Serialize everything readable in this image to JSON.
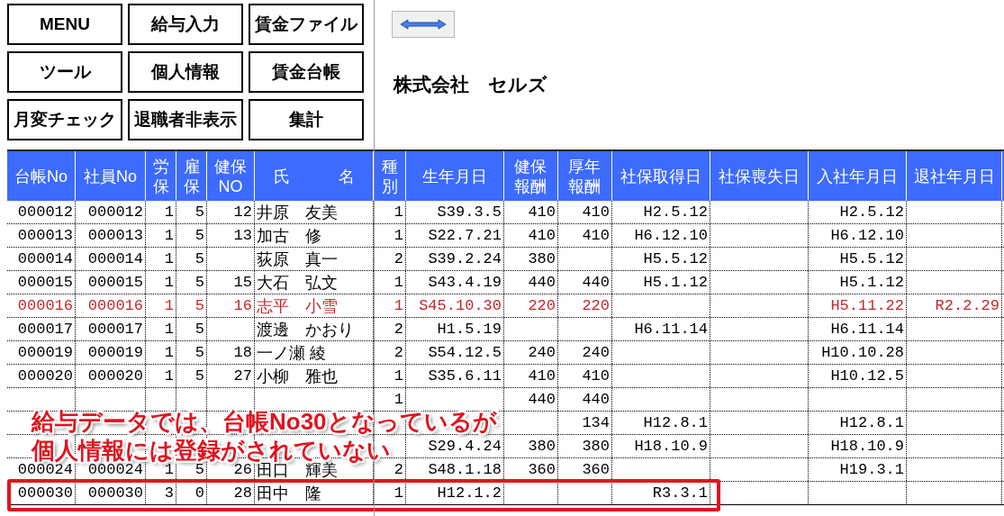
{
  "menu_buttons": [
    {
      "label": "MENU"
    },
    {
      "label": "給与入力"
    },
    {
      "label": "賃金ファイル"
    },
    {
      "label": "ツール"
    },
    {
      "label": "個人情報"
    },
    {
      "label": "賃金台帳"
    },
    {
      "label": "月変チェック"
    },
    {
      "label": "退職者非表示"
    },
    {
      "label": "集計"
    }
  ],
  "company_name": "株式会社　セルズ",
  "table": {
    "columns": [
      "台帳No",
      "社員No",
      "労保",
      "雇保",
      "健保NO",
      "氏　　　名",
      "種別",
      "生年月日",
      "健保報酬",
      "厚年報酬",
      "社保取得日",
      "社保喪失日",
      "入社年月日",
      "退社年月日"
    ],
    "rows": [
      {
        "retired": false,
        "highlighted": false,
        "ledger_no": "000012",
        "employee_no": "000012",
        "labor_ins": "1",
        "employment_ins": "5",
        "health_no": "12",
        "name": "井原　友美",
        "type": "1",
        "birth": "S39.3.5",
        "health_pay": "410",
        "pension_pay": "410",
        "acquired": "H2.5.12",
        "joined": "H2.5.12"
      },
      {
        "retired": false,
        "highlighted": false,
        "ledger_no": "000013",
        "employee_no": "000013",
        "labor_ins": "1",
        "employment_ins": "5",
        "health_no": "13",
        "name": "加古　修",
        "type": "1",
        "birth": "S22.7.21",
        "health_pay": "410",
        "pension_pay": "410",
        "acquired": "H6.12.10",
        "joined": "H6.12.10"
      },
      {
        "retired": false,
        "highlighted": false,
        "ledger_no": "000014",
        "employee_no": "000014",
        "labor_ins": "1",
        "employment_ins": "5",
        "name": "荻原　真一",
        "type": "2",
        "birth": "S39.2.24",
        "health_pay": "380",
        "acquired": "H5.5.12",
        "joined": "H5.5.12"
      },
      {
        "retired": false,
        "highlighted": false,
        "ledger_no": "000015",
        "employee_no": "000015",
        "labor_ins": "1",
        "employment_ins": "5",
        "health_no": "15",
        "name": "大石　弘文",
        "type": "1",
        "birth": "S43.4.19",
        "health_pay": "440",
        "pension_pay": "440",
        "acquired": "H5.1.12",
        "joined": "H5.1.12"
      },
      {
        "retired": true,
        "highlighted": false,
        "ledger_no": "000016",
        "employee_no": "000016",
        "labor_ins": "1",
        "employment_ins": "5",
        "health_no": "16",
        "name": "志平　小雪",
        "type": "1",
        "birth": "S45.10.30",
        "health_pay": "220",
        "pension_pay": "220",
        "joined": "H5.11.22",
        "left": "R2.2.29"
      },
      {
        "retired": false,
        "highlighted": false,
        "ledger_no": "000017",
        "employee_no": "000017",
        "labor_ins": "1",
        "employment_ins": "5",
        "name": "渡邊　かおり",
        "type": "2",
        "birth": "H1.5.19",
        "acquired": "H6.11.14",
        "joined": "H6.11.14"
      },
      {
        "retired": false,
        "highlighted": false,
        "ledger_no": "000019",
        "employee_no": "000019",
        "labor_ins": "1",
        "employment_ins": "5",
        "health_no": "18",
        "name": "一ノ瀬 綾",
        "type": "2",
        "birth": "S54.12.5",
        "health_pay": "240",
        "pension_pay": "240",
        "joined": "H10.10.28"
      },
      {
        "retired": false,
        "highlighted": false,
        "ledger_no": "000020",
        "employee_no": "000020",
        "labor_ins": "1",
        "employment_ins": "5",
        "health_no": "27",
        "name": "小柳　雅也",
        "type": "1",
        "birth": "S35.6.11",
        "health_pay": "410",
        "pension_pay": "410",
        "joined": "H10.12.5"
      },
      {
        "retired": false,
        "highlighted": false,
        "type": "1",
        "health_pay": "440",
        "pension_pay": "440"
      },
      {
        "retired": false,
        "highlighted": false,
        "pension_pay": "134",
        "acquired": "H12.8.1",
        "joined": "H12.8.1"
      },
      {
        "retired": false,
        "highlighted": false,
        "birth": "S29.4.24",
        "health_pay": "380",
        "pension_pay": "380",
        "acquired": "H18.10.9",
        "joined": "H18.10.9"
      },
      {
        "retired": false,
        "highlighted": false,
        "ledger_no": "000024",
        "employee_no": "000024",
        "labor_ins": "1",
        "employment_ins": "5",
        "health_no": "26",
        "name": "田口　輝美",
        "type": "2",
        "birth": "S48.1.18",
        "health_pay": "360",
        "pension_pay": "360",
        "joined": "H19.3.1"
      },
      {
        "retired": false,
        "highlighted": true,
        "ledger_no": "000030",
        "employee_no": "000030",
        "labor_ins": "3",
        "employment_ins": "0",
        "health_no": "28",
        "name": "田中　隆",
        "type": "1",
        "birth": "H12.1.2",
        "acquired": "R3.3.1"
      }
    ]
  },
  "annotation": {
    "lines": [
      "給与データでは、台帳No30となっているが",
      "個人情報には登録がされていない"
    ]
  }
}
